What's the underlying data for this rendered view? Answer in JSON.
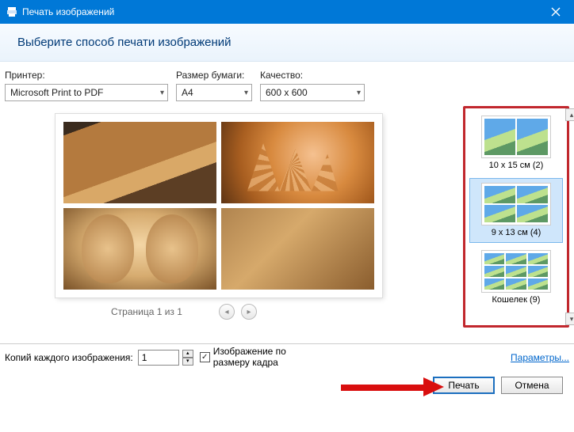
{
  "titlebar": {
    "title": "Печать изображений"
  },
  "header": {
    "text": "Выберите способ печати изображений"
  },
  "controls": {
    "printer_label": "Принтер:",
    "printer_value": "Microsoft Print to PDF",
    "paper_label": "Размер бумаги:",
    "paper_value": "A4",
    "quality_label": "Качество:",
    "quality_value": "600 x 600"
  },
  "pager": {
    "text": "Страница 1 из 1"
  },
  "layouts": [
    {
      "label": "10 x 15 см (2)",
      "grid": 2,
      "selected": false
    },
    {
      "label": "9 x 13 см (4)",
      "grid": 4,
      "selected": true
    },
    {
      "label": "Кошелек (9)",
      "grid": 9,
      "selected": false
    }
  ],
  "footer": {
    "copies_label": "Копий каждого изображения:",
    "copies_value": "1",
    "fit_label_1": "Изображение по",
    "fit_label_2": "размеру кадра",
    "fit_checked": "✓",
    "params_link": "Параметры...",
    "print_btn": "Печать",
    "cancel_btn": "Отмена"
  }
}
